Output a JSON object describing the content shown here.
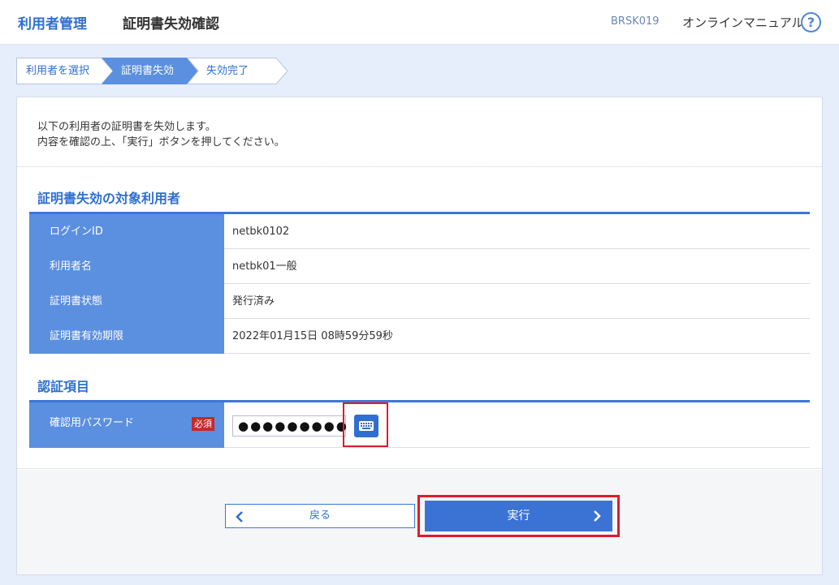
{
  "header": {
    "section_title": "利用者管理",
    "page_title": "証明書失効確認",
    "screen_id": "BRSK019",
    "manual_link": "オンラインマニュアル",
    "help_icon": "?"
  },
  "steps": [
    {
      "label": "利用者を選択",
      "state": "done"
    },
    {
      "label": "証明書失効",
      "state": "current"
    },
    {
      "label": "失効完了",
      "state": "upcoming"
    }
  ],
  "intro": {
    "line1": "以下の利用者の証明書を失効します。",
    "line2": "内容を確認の上、「実行」ボタンを押してください。"
  },
  "target_section": {
    "heading": "証明書失効の対象利用者",
    "rows": [
      {
        "label": "ログインID",
        "value": "netbk0102"
      },
      {
        "label": "利用者名",
        "value": "netbk01一般"
      },
      {
        "label": "証明書状態",
        "value": "発行済み"
      },
      {
        "label": "証明書有効期限",
        "value": "2022年01月15日 08時59分59秒"
      }
    ]
  },
  "auth_section": {
    "heading": "認証項目",
    "password_label": "確認用パスワード",
    "required_badge": "必須",
    "password_value": "●●●●●●●●●"
  },
  "buttons": {
    "back": "戻る",
    "execute": "実行"
  },
  "colors": {
    "accent": "#2f6fd1",
    "header_cell": "#5b8fe0",
    "highlight": "#e01b2a",
    "required": "#c6282b"
  }
}
